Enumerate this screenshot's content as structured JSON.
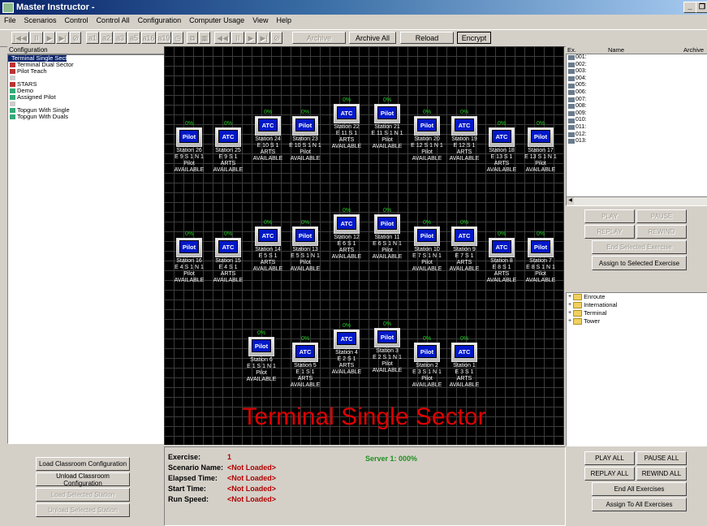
{
  "window": {
    "title": "Master Instructor -"
  },
  "menu": [
    "File",
    "Scenarios",
    "Control",
    "Control All",
    "Configuration",
    "Computer Usage",
    "View",
    "Help"
  ],
  "toolbar": {
    "media_left": [
      "|◀◀",
      "II",
      "▶",
      "▶|",
      "⊘"
    ],
    "slot_buttons": [
      "a1",
      "a2",
      "a3",
      "a5",
      "a16",
      "a19"
    ],
    "media_right": [
      "◀◀",
      "II",
      "▶",
      "▶|",
      "⊘"
    ],
    "archive_selected": "Archive Selected",
    "archive_all": "Archive All",
    "reload": "Reload",
    "encrypt": "Encrypt"
  },
  "configuration": {
    "header": "Configuration",
    "items": [
      "Terminal Single Sector",
      "Terminal Dual Sector",
      "Pilot Teach",
      "",
      "STARS",
      "Demo",
      "Assigned Pilot",
      "",
      "Topgun With Single",
      "Topgun With Duals"
    ]
  },
  "stations": [
    {
      "num": "26",
      "type": "Pilot",
      "pct": "0%",
      "lines": "Station 26\nE 9 S 1 N 1\nPilot\nAVAILABLE"
    },
    {
      "num": "25",
      "type": "ATC",
      "pct": "0%",
      "lines": "Station 25\nE 9 S 1\nARTS\nAVAILABLE"
    },
    {
      "num": "24",
      "type": "ATC",
      "pct": "0%",
      "lines": "Station 24\nE 10 S 1\nARTS\nAVAILABLE"
    },
    {
      "num": "23",
      "type": "Pilot",
      "pct": "0%",
      "lines": "Station 23\nE 10 S 1 N 1\nPilot\nAVAILABLE"
    },
    {
      "num": "22",
      "type": "ATC",
      "pct": "0%",
      "lines": "Station 22\nE 11 S 1\nARTS\nAVAILABLE"
    },
    {
      "num": "21",
      "type": "Pilot",
      "pct": "0%",
      "lines": "Station 21\nE 11 S 1 N 1\nPilot\nAVAILABLE"
    },
    {
      "num": "20",
      "type": "Pilot",
      "pct": "0%",
      "lines": "Station 20\nE 12 S 1 N 1\nPilot\nAVAILABLE"
    },
    {
      "num": "19",
      "type": "ATC",
      "pct": "0%",
      "lines": "Station 19\nE 12 S 1\nARTS\nAVAILABLE"
    },
    {
      "num": "18",
      "type": "ATC",
      "pct": "0%",
      "lines": "Station 18\nE 13 S 1\nARTS\nAVAILABLE"
    },
    {
      "num": "17",
      "type": "Pilot",
      "pct": "0%",
      "lines": "Station 17\nE 13 S 1 N 1\nPilot\nAVAILABLE"
    },
    {
      "num": "16",
      "type": "Pilot",
      "pct": "0%",
      "lines": "Station 16\nE 4 S 1 N 1\nPilot\nAVAILABLE"
    },
    {
      "num": "15",
      "type": "ATC",
      "pct": "0%",
      "lines": "Station 15\nE 4 S 1\nARTS\nAVAILABLE"
    },
    {
      "num": "14",
      "type": "ATC",
      "pct": "0%",
      "lines": "Station 14\nE 5 S 1\nARTS\nAVAILABLE"
    },
    {
      "num": "13",
      "type": "Pilot",
      "pct": "0%",
      "lines": "Station 13\nE 5 S 1 N 1\nPilot\nAVAILABLE"
    },
    {
      "num": "12",
      "type": "ATC",
      "pct": "0%",
      "lines": "Station 12\nE 6 S 1\nARTS\nAVAILABLE"
    },
    {
      "num": "11",
      "type": "Pilot",
      "pct": "0%",
      "lines": "Station 11\nE 6 S 1 N 1\nPilot\nAVAILABLE"
    },
    {
      "num": "10",
      "type": "Pilot",
      "pct": "0%",
      "lines": "Station 10\nE 7 S 1 N 1\nPilot\nAVAILABLE"
    },
    {
      "num": "9",
      "type": "ATC",
      "pct": "0%",
      "lines": "Station 9\nE 7 S 1\nARTS\nAVAILABLE"
    },
    {
      "num": "8",
      "type": "ATC",
      "pct": "0%",
      "lines": "Station 8\nE 8 S 1\nARTS\nAVAILABLE"
    },
    {
      "num": "7",
      "type": "Pilot",
      "pct": "0%",
      "lines": "Station 7\nE 8 S 1 N 1\nPilot\nAVAILABLE"
    },
    {
      "num": "6",
      "type": "Pilot",
      "pct": "0%",
      "lines": "Station 6\nE 1 S 1 N 1\nPilot\nAVAILABLE"
    },
    {
      "num": "5",
      "type": "ATC",
      "pct": "0%",
      "lines": "Station 5\nE 1 S 1\nARTS\nAVAILABLE"
    },
    {
      "num": "4",
      "type": "ATC",
      "pct": "0%",
      "lines": "Station 4\nE 2 S 1\nARTS\nAVAILABLE"
    },
    {
      "num": "3",
      "type": "Pilot",
      "pct": "0%",
      "lines": "Station 3\nE 2 S 1 N 1\nPilot\nAVAILABLE"
    },
    {
      "num": "2",
      "type": "Pilot",
      "pct": "0%",
      "lines": "Station 2\nE 3 S 1 N 1\nPilot\nAVAILABLE"
    },
    {
      "num": "1",
      "type": "ATC",
      "pct": "0%",
      "lines": "Station 1\nE 3 S 1\nARTS\nAVAILABLE"
    }
  ],
  "classroom_title": "Terminal Single Sector",
  "exercises": {
    "headers": [
      "Ex.",
      "Name",
      "Archive"
    ],
    "rows": [
      "001:",
      "002:",
      "003:",
      "004:",
      "005:",
      "006:",
      "007:",
      "008:",
      "009:",
      "010:",
      "011:",
      "012:",
      "013:"
    ]
  },
  "exercise_controls": {
    "play": "PLAY",
    "pause": "PAUSE",
    "replay": "REPLAY",
    "rewind": "REWIND",
    "end_selected": "End Selected Exercise",
    "assign_selected": "Assign to Selected Exercise"
  },
  "scenario_tree": [
    "Enroute",
    "International",
    "Terminal",
    "Tower"
  ],
  "classroom_buttons": {
    "load": "Load Classroom Configuration",
    "unload": "Unload Classroom Configuration",
    "load_station": "Load Selected Station",
    "unload_station": "Unload Selected Station"
  },
  "info": {
    "exercise_label": "Exercise:",
    "exercise_value": "1",
    "scenario_label": "Scenario Name:",
    "scenario_value": "<Not Loaded>",
    "elapsed_label": "Elapsed Time:",
    "elapsed_value": "<Not Loaded>",
    "start_label": "Start Time:",
    "start_value": "<Not Loaded>",
    "speed_label": "Run Speed:",
    "speed_value": "<Not Loaded>",
    "server": "Server 1:  000%"
  },
  "all_controls": {
    "play_all": "PLAY ALL",
    "pause_all": "PAUSE ALL",
    "replay_all": "REPLAY ALL",
    "rewind_all": "REWIND ALL",
    "end_all": "End All Exercises",
    "assign_all": "Assign To All Exercises"
  }
}
